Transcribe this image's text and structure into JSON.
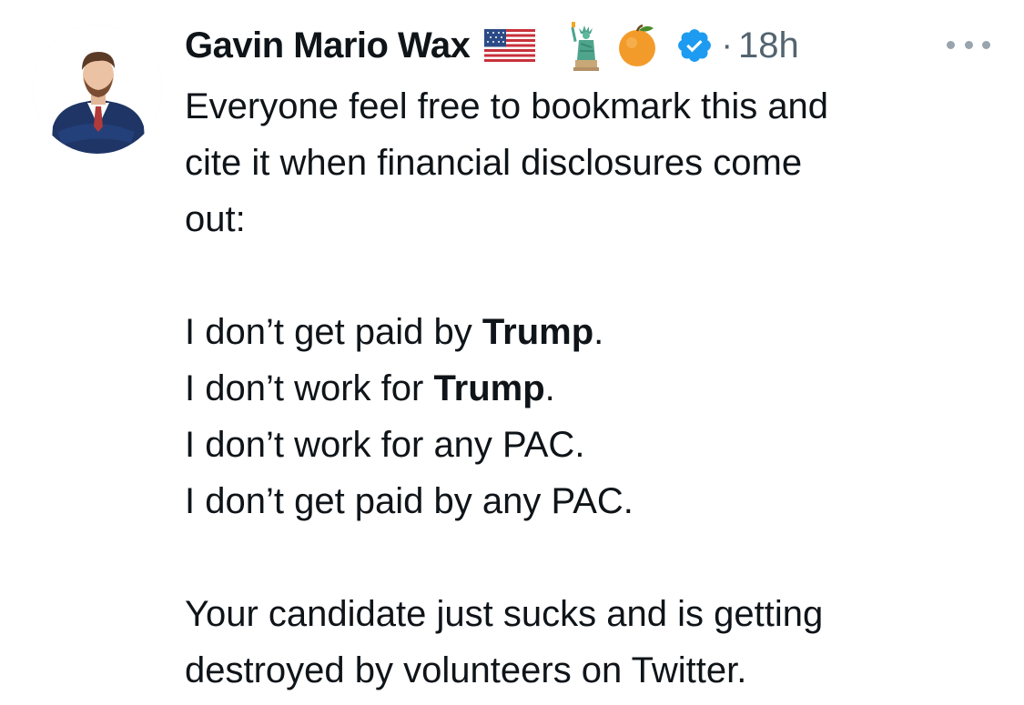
{
  "author": {
    "name": "Gavin Mario Wax",
    "timestamp": "18h",
    "separator": "·",
    "emoji_icons": [
      "us-flag-icon",
      "statue-of-liberty-icon",
      "orange-icon"
    ],
    "verified_badge": "verified-badge-icon"
  },
  "tweet": {
    "paragraph1": {
      "line1": "Everyone feel free to bookmark this and",
      "line2": "cite it when financial disclosures come",
      "line3": "out:"
    },
    "paragraph2": {
      "line1_prefix": "I don’t get paid by ",
      "line1_bold": "Trump",
      "line1_suffix": ".",
      "line2_prefix": "I don’t work for ",
      "line2_bold": "Trump",
      "line2_suffix": ".",
      "line3": "I don’t work for any PAC.",
      "line4": "I don’t get paid by any PAC."
    },
    "paragraph3": {
      "line1": "Your candidate just sucks and is getting",
      "line2": "destroyed by volunteers on Twitter."
    }
  },
  "colors": {
    "text": "#0f1419",
    "secondary": "#536471",
    "verified": "#1d9bf0",
    "suit": "#1f3566"
  }
}
